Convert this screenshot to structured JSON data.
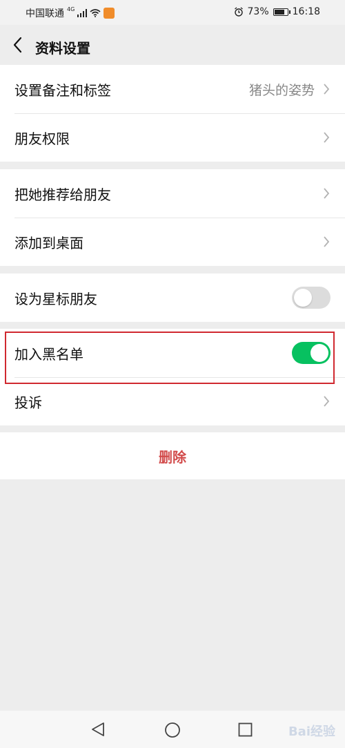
{
  "status_bar": {
    "carrier": "中国联通",
    "network": "4G",
    "battery": "73%",
    "time": "16:18"
  },
  "nav": {
    "title": "资料设置"
  },
  "groups": [
    {
      "items": [
        {
          "label": "设置备注和标签",
          "value": "猪头的姿势"
        },
        {
          "label": "朋友权限"
        }
      ]
    },
    {
      "items": [
        {
          "label": "把她推荐给朋友"
        },
        {
          "label": "添加到桌面"
        }
      ]
    },
    {
      "items": [
        {
          "label": "设为星标朋友",
          "toggle": false
        }
      ]
    },
    {
      "items": [
        {
          "label": "加入黑名单",
          "toggle": true
        },
        {
          "label": "投诉"
        }
      ]
    }
  ],
  "delete_label": "删除",
  "colors": {
    "accent_green": "#07c160",
    "delete_red": "#d24b4b",
    "highlight_red": "#d0282f",
    "background": "#ededed"
  },
  "watermark": "Bai经验"
}
